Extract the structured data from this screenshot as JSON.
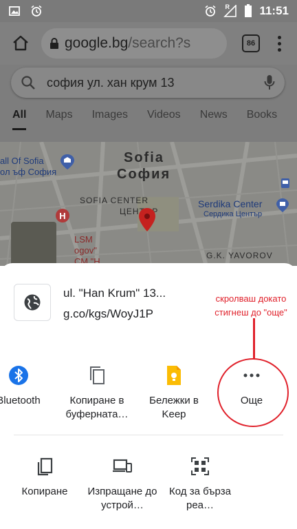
{
  "status_bar": {
    "time": "11:51",
    "network_label": "R",
    "icons": [
      "image-icon",
      "alarm-icon",
      "alarm-icon",
      "signal-icon",
      "battery-icon"
    ]
  },
  "browser": {
    "url_host": "google.bg",
    "url_path": "/search?s",
    "tab_count": "86"
  },
  "search": {
    "query": "софия ул. хан крум 13",
    "tabs": [
      "All",
      "Maps",
      "Images",
      "Videos",
      "News",
      "Books"
    ]
  },
  "map": {
    "labels": {
      "city_en": "Sofia",
      "city_bg": "София",
      "center_en": "SOFIA CENTER",
      "center_bg": "ЦЕНТЪР",
      "hall_en": "all Of Sofia",
      "hall_bg": "ол ъф София",
      "serdika_en": "Serdika Center",
      "serdika_bg": "Сердика Център",
      "lsm": "LSM",
      "ogov": "ogov\"",
      "sm_h": "СМ \"Н",
      "yavorov": "G.K. YAVOROV"
    }
  },
  "share_sheet": {
    "link_title": "ul. \"Han Krum\" 13...",
    "link_url": "g.co/kgs/WoyJ1P",
    "apps": [
      {
        "label": "Bluetooth",
        "icon": "bluetooth-icon"
      },
      {
        "label": "Копиране в буферната…",
        "icon": "copy-icon"
      },
      {
        "label": "Бележки в Keep",
        "icon": "keep-icon"
      },
      {
        "label": "Още",
        "icon": "more-icon"
      }
    ],
    "actions": [
      {
        "label": "Копиране",
        "icon": "copy-icon"
      },
      {
        "label": "Изпращане до устрой…",
        "icon": "send-to-device-icon"
      },
      {
        "label": "Код за бърза реа…",
        "icon": "qr-code-icon"
      }
    ]
  },
  "annotation": {
    "line1": "скролваш докато",
    "line2": "стигнеш до \"още\""
  },
  "colors": {
    "annotation_red": "#e0202a",
    "bluetooth_blue": "#1a73e8",
    "keep_yellow": "#fbbc04",
    "map_pin_red": "#c5221f"
  }
}
